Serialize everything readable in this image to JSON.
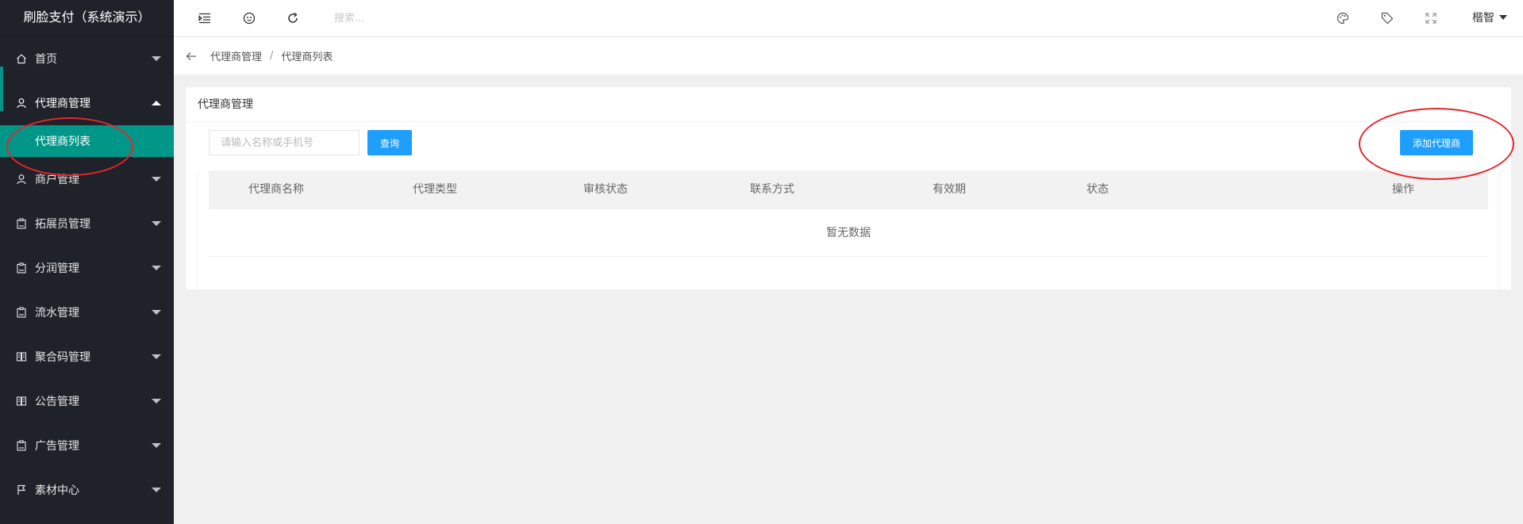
{
  "app": {
    "brand": "刷脸支付（系统演示）"
  },
  "sidebar": {
    "items": [
      {
        "label": "首页",
        "icon": "home-icon"
      },
      {
        "label": "代理商管理",
        "icon": "user-icon",
        "open": true,
        "children": [
          {
            "label": "代理商列表",
            "active": true
          }
        ]
      },
      {
        "label": "商户管理",
        "icon": "user-icon"
      },
      {
        "label": "拓展员管理",
        "icon": "clipboard-icon"
      },
      {
        "label": "分润管理",
        "icon": "clipboard-icon"
      },
      {
        "label": "流水管理",
        "icon": "clipboard-icon"
      },
      {
        "label": "聚合码管理",
        "icon": "document-icon"
      },
      {
        "label": "公告管理",
        "icon": "document-icon"
      },
      {
        "label": "广告管理",
        "icon": "clipboard-icon"
      },
      {
        "label": "素材中心",
        "icon": "flag-icon"
      }
    ]
  },
  "topbar": {
    "search_placeholder": "搜索...",
    "user_name": "楷智"
  },
  "breadcrumb": {
    "items": [
      "代理商管理",
      "代理商列表"
    ]
  },
  "card": {
    "title": "代理商管理",
    "query_placeholder": "请输入名称或手机号",
    "query_button": "查询",
    "add_button": "添加代理商"
  },
  "table": {
    "columns": [
      "代理商名称",
      "代理类型",
      "审核状态",
      "联系方式",
      "有效期",
      "状态",
      "操作"
    ],
    "empty_text": "暂无数据"
  },
  "colors": {
    "sidebar_bg": "#20222a",
    "accent": "#009688",
    "primary": "#1e9fff",
    "annotation": "#e8252a"
  }
}
